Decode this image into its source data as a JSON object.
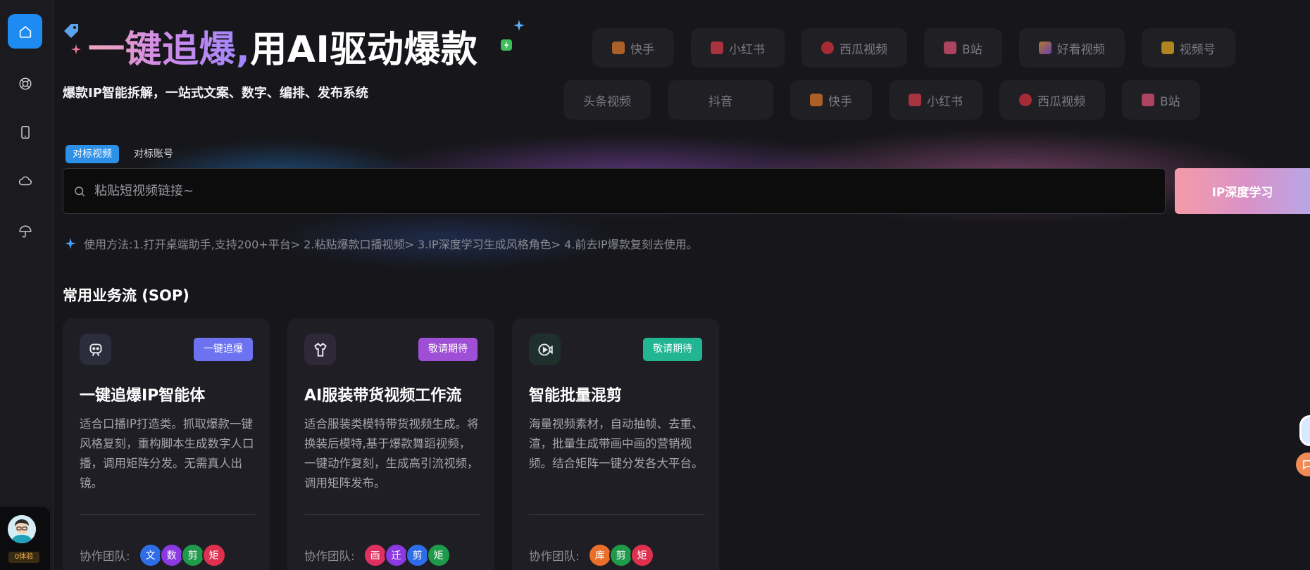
{
  "sidebar": {
    "items": [
      {
        "name": "home",
        "icon": "home-icon"
      },
      {
        "name": "lifebuoy",
        "icon": "lifebuoy-icon"
      },
      {
        "name": "mobile",
        "icon": "mobile-icon"
      },
      {
        "name": "cloud",
        "icon": "cloud-icon"
      },
      {
        "name": "umbrella",
        "icon": "umbrella-icon"
      }
    ],
    "user": {
      "badge": "0体验"
    }
  },
  "hero": {
    "title_gradient": "一键追爆,",
    "title_white": "用AI驱动爆款",
    "subtitle": "爆款IP智能拆解，一站式文案、数字、编排、发布系统"
  },
  "platforms_row1": [
    "快手",
    "小红书",
    "西瓜视频",
    "B站",
    "好看视频",
    "视频号"
  ],
  "platforms_row2": [
    "头条视频",
    "抖音",
    "快手",
    "小红书",
    "西瓜视频",
    "B站"
  ],
  "search": {
    "tabs": [
      "对标视频",
      "对标账号"
    ],
    "placeholder": "粘贴短视频链接~",
    "button": "IP深度学习",
    "usage": "使用方法:1.打开桌端助手,支持200+平台> 2.粘贴爆款口播视频> 3.IP深度学习生成风格角色> 4.前去IP爆款复刻去使用。"
  },
  "section": {
    "title": "常用业务流 (SOP)"
  },
  "cards": [
    {
      "tag": "一键追爆",
      "title": "一键追爆IP智能体",
      "desc": "适合口播IP打造类。抓取爆款一键风格复刻，重构脚本生成数字人口播，调用矩阵分发。无需真人出镜。",
      "team_label": "协作团队:",
      "team": [
        "文",
        "数",
        "剪",
        "矩"
      ]
    },
    {
      "tag": "敬请期待",
      "title": "AI服装带货视频工作流",
      "desc": "适合服装类模特带货视频生成。将换装后模特,基于爆款舞蹈视频，一键动作复刻，生成高引流视频，调用矩阵发布。",
      "team_label": "协作团队:",
      "team": [
        "画",
        "迁",
        "剪",
        "矩"
      ]
    },
    {
      "tag": "敬请期待",
      "title": "智能批量混剪",
      "desc": "海量视频素材，自动抽帧、去重、渲，批量生成带画中画的营销视频。结合矩阵一键分发各大平台。",
      "team_label": "协作团队:",
      "team": [
        "库",
        "剪",
        "矩"
      ]
    }
  ],
  "colors": {
    "accent_blue": "#1d8bf2",
    "tag_blue": "#6c72f0",
    "tag_purple": "#9f4fd6",
    "tag_teal": "#21b592"
  }
}
